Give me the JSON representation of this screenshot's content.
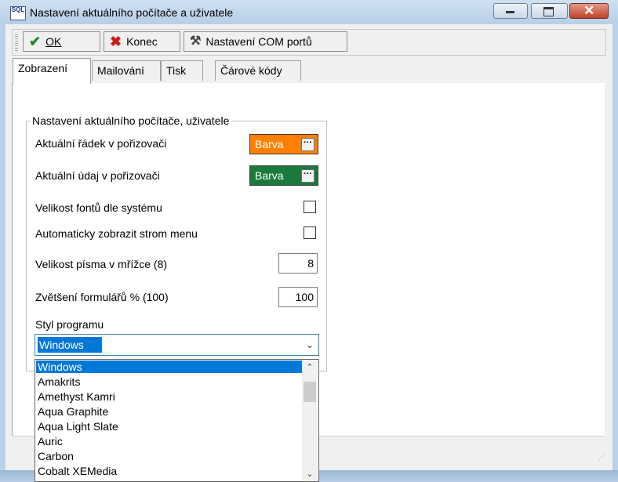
{
  "window": {
    "title": "Nastavení aktuálního počítače a uživatele",
    "icon_label": "SQL",
    "buttons": [
      "minimize-icon",
      "maximize-icon",
      "close-icon"
    ]
  },
  "toolbar": {
    "ok_label": "OK",
    "konec_label": "Konec",
    "com_label": "Nastavení COM portů"
  },
  "tabs": [
    {
      "label": "Zobrazení",
      "active": true
    },
    {
      "label": "Mailování",
      "active": false
    },
    {
      "label": "Tisk",
      "active": false
    },
    {
      "label": "Čárové kódy",
      "active": false
    }
  ],
  "group": {
    "title": "Nastavení aktuálního počítače, uživatele",
    "row_current_line": "Aktuální řádek v pořizovači",
    "row_current_value": "Aktuální údaj v pořizovači",
    "color_button_label": "Barva",
    "color_current_line": "#ff8000",
    "color_current_value": "#1a7a3c",
    "font_size_system": "Velikost fontů dle systému",
    "auto_tree_menu": "Automaticky zobrazit strom menu",
    "grid_font_label": "Velikost písma v mřížce (8)",
    "grid_font_value": "8",
    "form_zoom_label": "Zvětšení formulářů % (100)",
    "form_zoom_value": "100",
    "style_label": "Styl programu",
    "style_selected": "Windows"
  },
  "dropdown": {
    "items": [
      "Windows",
      "Amakrits",
      "Amethyst Kamri",
      "Aqua Graphite",
      "Aqua Light Slate",
      "Auric",
      "Carbon",
      "Cobalt XEMedia"
    ]
  }
}
